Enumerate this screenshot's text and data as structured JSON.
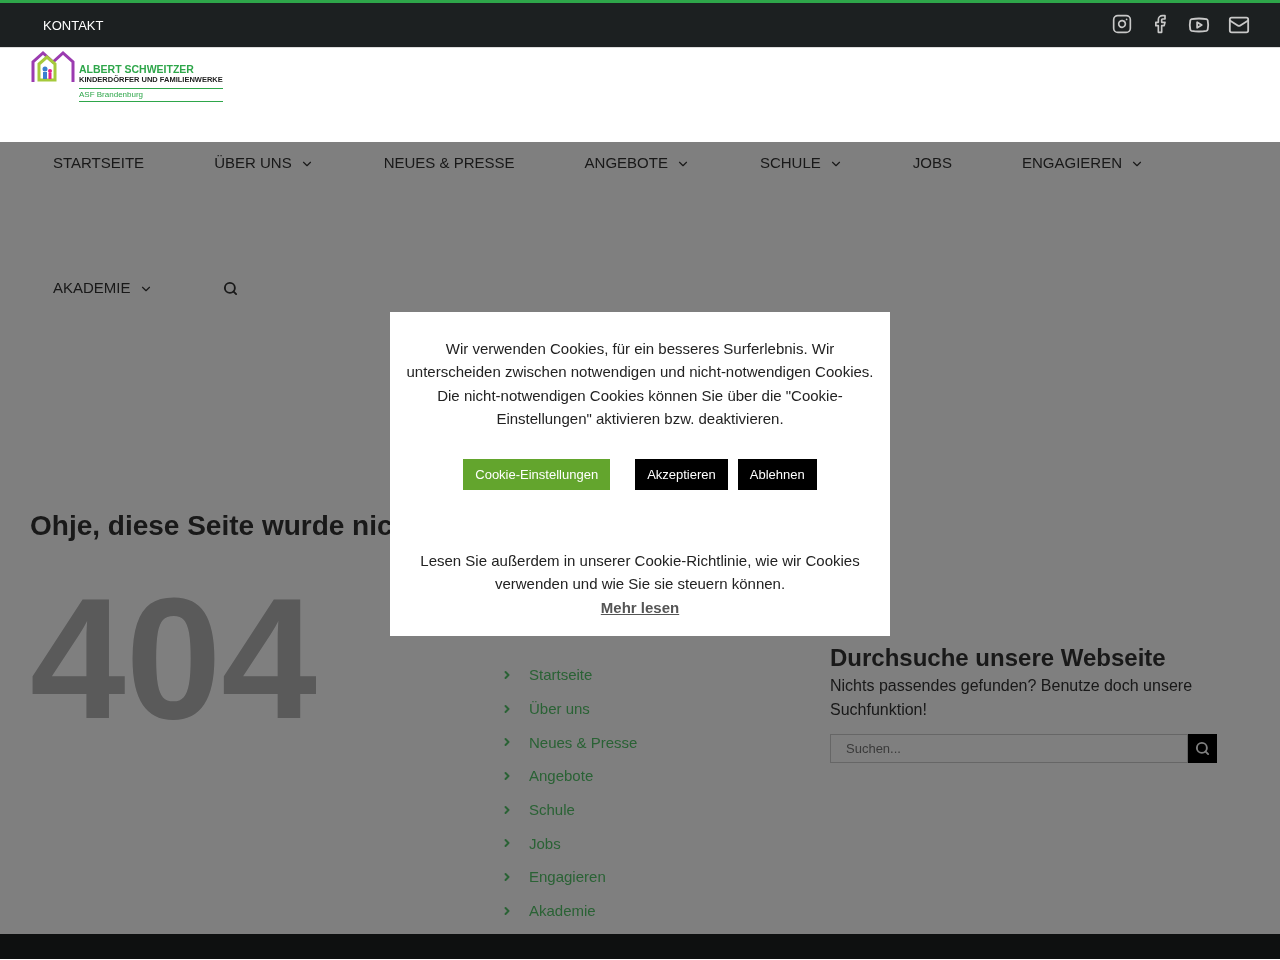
{
  "top_bar": {
    "link": "KONTAKT"
  },
  "logo": {
    "title": "ALBERT SCHWEITZER",
    "subtitle": "KINDERDÖRFER UND FAMILIENWERKE",
    "region": "ASF Brandenburg"
  },
  "nav": {
    "items": [
      {
        "label": "STARTSEITE",
        "dropdown": false
      },
      {
        "label": "ÜBER UNS",
        "dropdown": true
      },
      {
        "label": "NEUES & PRESSE",
        "dropdown": false
      },
      {
        "label": "ANGEBOTE",
        "dropdown": true
      },
      {
        "label": "SCHULE",
        "dropdown": true
      },
      {
        "label": "JOBS",
        "dropdown": false
      },
      {
        "label": "ENGAGIEREN",
        "dropdown": true
      },
      {
        "label": "AKADEMIE",
        "dropdown": true
      }
    ]
  },
  "page": {
    "heading": "Ohje, diese Seite wurde nic",
    "error_code": "404",
    "links": [
      "Startseite",
      "Über uns",
      "Neues & Presse",
      "Angebote",
      "Schule",
      "Jobs",
      "Engagieren",
      "Akademie"
    ],
    "search": {
      "title": "Durchsuche unsere Webseite",
      "text": "Nichts passendes gefunden? Benutze doch unsere Suchfunktion!",
      "placeholder": "Suchen..."
    }
  },
  "cookie_dialog": {
    "text": "Wir verwenden Cookies, für ein besseres Surferlebnis. Wir unterscheiden zwischen notwendigen und nicht-notwendigen Cookies. Die nicht-notwendigen Cookies können Sie über die \"Cookie-Einstellungen\" aktivieren bzw. deaktivieren.",
    "buttons": [
      {
        "label": "Cookie-Einstellungen",
        "kind": "settings"
      },
      {
        "label": "Akzeptieren",
        "kind": "accept"
      },
      {
        "label": "Ablehnen",
        "kind": "reject"
      }
    ],
    "policy_text": "Lesen Sie außerdem in unserer Cookie-Richtlinie, wie wir Cookies verwenden und wie Sie sie steuern können.",
    "read_more": "Mehr lesen"
  }
}
